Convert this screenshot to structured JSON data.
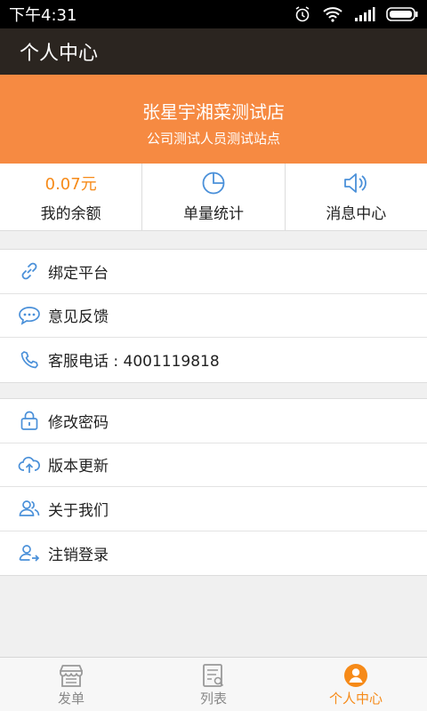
{
  "status": {
    "time": "下午4:31"
  },
  "header": {
    "title": "个人中心"
  },
  "store": {
    "name": "张星宇湘菜测试店",
    "subtitle": "公司测试人员测试站点"
  },
  "stats": [
    {
      "value": "0.07元",
      "label": "我的余额"
    },
    {
      "icon": "pie-chart-icon",
      "label": "单量统计"
    },
    {
      "icon": "speaker-icon",
      "label": "消息中心"
    }
  ],
  "menu1": [
    {
      "icon": "link-icon",
      "label": "绑定平台"
    },
    {
      "icon": "chat-bubble-icon",
      "label": "意见反馈"
    },
    {
      "icon": "phone-icon",
      "label": "客服电话 : 4001119818"
    }
  ],
  "menu2": [
    {
      "icon": "lock-icon",
      "label": "修改密码"
    },
    {
      "icon": "cloud-upload-icon",
      "label": "版本更新"
    },
    {
      "icon": "people-icon",
      "label": "关于我们"
    },
    {
      "icon": "logout-user-icon",
      "label": "注销登录"
    }
  ],
  "tabs": [
    {
      "icon": "shop-icon",
      "label": "发单"
    },
    {
      "icon": "list-search-icon",
      "label": "列表"
    },
    {
      "icon": "person-icon",
      "label": "个人中心",
      "active": true
    }
  ],
  "colors": {
    "accent": "#f68a18",
    "hero": "#f68a42",
    "icon": "#4a90d9"
  }
}
